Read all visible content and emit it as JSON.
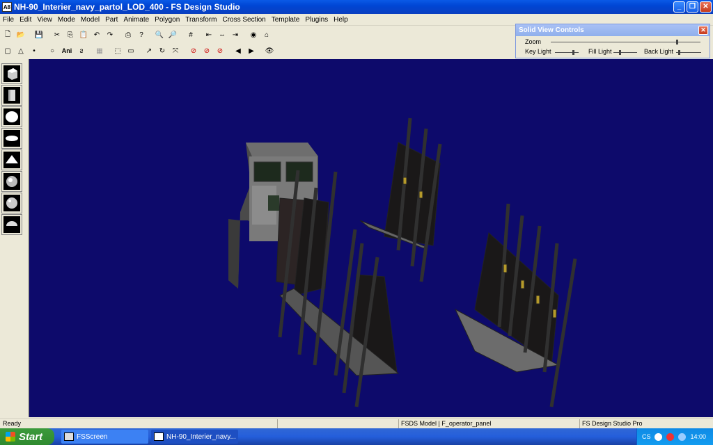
{
  "window": {
    "title": "NH-90_Interier_navy_partol_LOD_400 - FS Design Studio",
    "app_icon_label": "A8",
    "buttons": [
      "minimize-icon",
      "maximize-icon",
      "close-icon"
    ]
  },
  "menu": [
    "File",
    "Edit",
    "View",
    "Mode",
    "Model",
    "Part",
    "Animate",
    "Polygon",
    "Transform",
    "Cross Section",
    "Template",
    "Plugins",
    "Help"
  ],
  "toolbar_row1": [
    "new-file-icon",
    "open-folder-icon",
    "sep",
    "save-icon",
    "sep",
    "cut-icon",
    "copy-icon",
    "paste-icon",
    "undo-icon",
    "redo-icon",
    "sep",
    "print-icon",
    "help-icon",
    "sep",
    "zoom-in-icon",
    "zoom-out-icon",
    "sep",
    "grid-icon",
    "sep",
    "align-left-icon",
    "align-center-icon",
    "align-right-icon",
    "sep",
    "view-mode-icon",
    "home-icon"
  ],
  "toolbar_row1_glyphs": [
    "🗋",
    "📂",
    "",
    "💾",
    "",
    "✂",
    "⎘",
    "📋",
    "↶",
    "↷",
    "",
    "⎙",
    "?",
    "",
    "🔍",
    "🔎",
    "",
    "#",
    "",
    "⇤",
    "⇔",
    "⇥",
    "",
    "◉",
    "⌂"
  ],
  "toolbar_row2": [
    "select-icon",
    "triangle-icon",
    "point-icon",
    "sep",
    "circle-icon",
    "animate-label",
    "script-icon",
    "sep",
    "texture-icon",
    "sep",
    "select-box-icon",
    "measure-icon",
    "sep",
    "rotate-icon",
    "refresh-icon",
    "scale-icon",
    "sep",
    "stop-icon",
    "stop-icon",
    "cancel-icon",
    "sep",
    "prev-icon",
    "next-icon",
    "sep",
    "binoculars-icon"
  ],
  "toolbar_row2_glyphs": [
    "▢",
    "△",
    "•",
    "",
    "○",
    "Ani",
    "ƨ",
    "",
    "▦",
    "",
    "⬚",
    "▭",
    "",
    "↗",
    "↻",
    "⤧",
    "",
    "⊘",
    "⊘",
    "⊘",
    "",
    "◀",
    "▶",
    "",
    "👁"
  ],
  "palette": [
    "cube-icon",
    "cylinder-icon",
    "sphere-icon",
    "ellipsoid-icon",
    "pyramid-icon",
    "globe-icon",
    "globe-detailed-icon",
    "hemisphere-icon"
  ],
  "solid_view_controls": {
    "title": "Solid View Controls",
    "zoom_label": "Zoom",
    "key_light_label": "Key Light",
    "fill_light_label": "Fill Light",
    "back_light_label": "Back Light",
    "zoom_level": 0.85,
    "key_light_level": 0.8,
    "fill_light_level": 0.25,
    "back_light_level": 0.1
  },
  "status": {
    "left": "Ready",
    "middle": "FSDS Model | F_operator_panel",
    "right": "FS Design Studio Pro"
  },
  "taskbar": {
    "start_label": "Start",
    "tasks": [
      "FSScreen",
      "NH-90_Interier_navy..."
    ],
    "tray_lang": "CS",
    "tray_time": "14:00"
  },
  "colors": {
    "viewport_bg": "#0d0a6b",
    "title_blue": "#0046d5"
  }
}
